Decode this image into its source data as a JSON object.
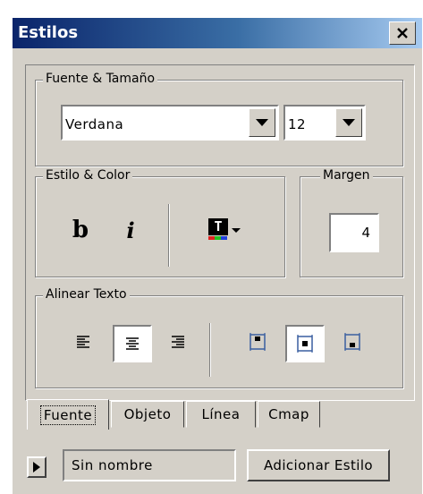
{
  "window": {
    "title": "Estilos"
  },
  "font_group": {
    "legend": "Fuente & Tamaño",
    "font_value": "Verdana",
    "size_value": "12"
  },
  "style_group": {
    "legend": "Estilo & Color",
    "bold_glyph": "b",
    "italic_glyph": "i",
    "color_icon_glyph": "T"
  },
  "margin_group": {
    "legend": "Margen",
    "value": "4"
  },
  "align_group": {
    "legend": "Alinear Texto"
  },
  "tabs": [
    {
      "label": "Fuente",
      "active": true
    },
    {
      "label": "Objeto",
      "active": false
    },
    {
      "label": "Línea",
      "active": false
    },
    {
      "label": "Cmap",
      "active": false
    }
  ],
  "bottom": {
    "style_name": "Sin nombre",
    "add_button": "Adicionar Estilo"
  },
  "colors": {
    "titlebar_start": "#0a246a",
    "titlebar_end": "#a6caf0",
    "face": "#d4d0c8",
    "icon_blue": "#3a5fa0"
  },
  "icons": [
    "close-icon",
    "chevron-down-icon",
    "text-color-icon",
    "align-left-icon",
    "align-center-icon",
    "align-right-icon",
    "valign-top-icon",
    "valign-middle-icon",
    "valign-bottom-icon",
    "play-icon"
  ]
}
